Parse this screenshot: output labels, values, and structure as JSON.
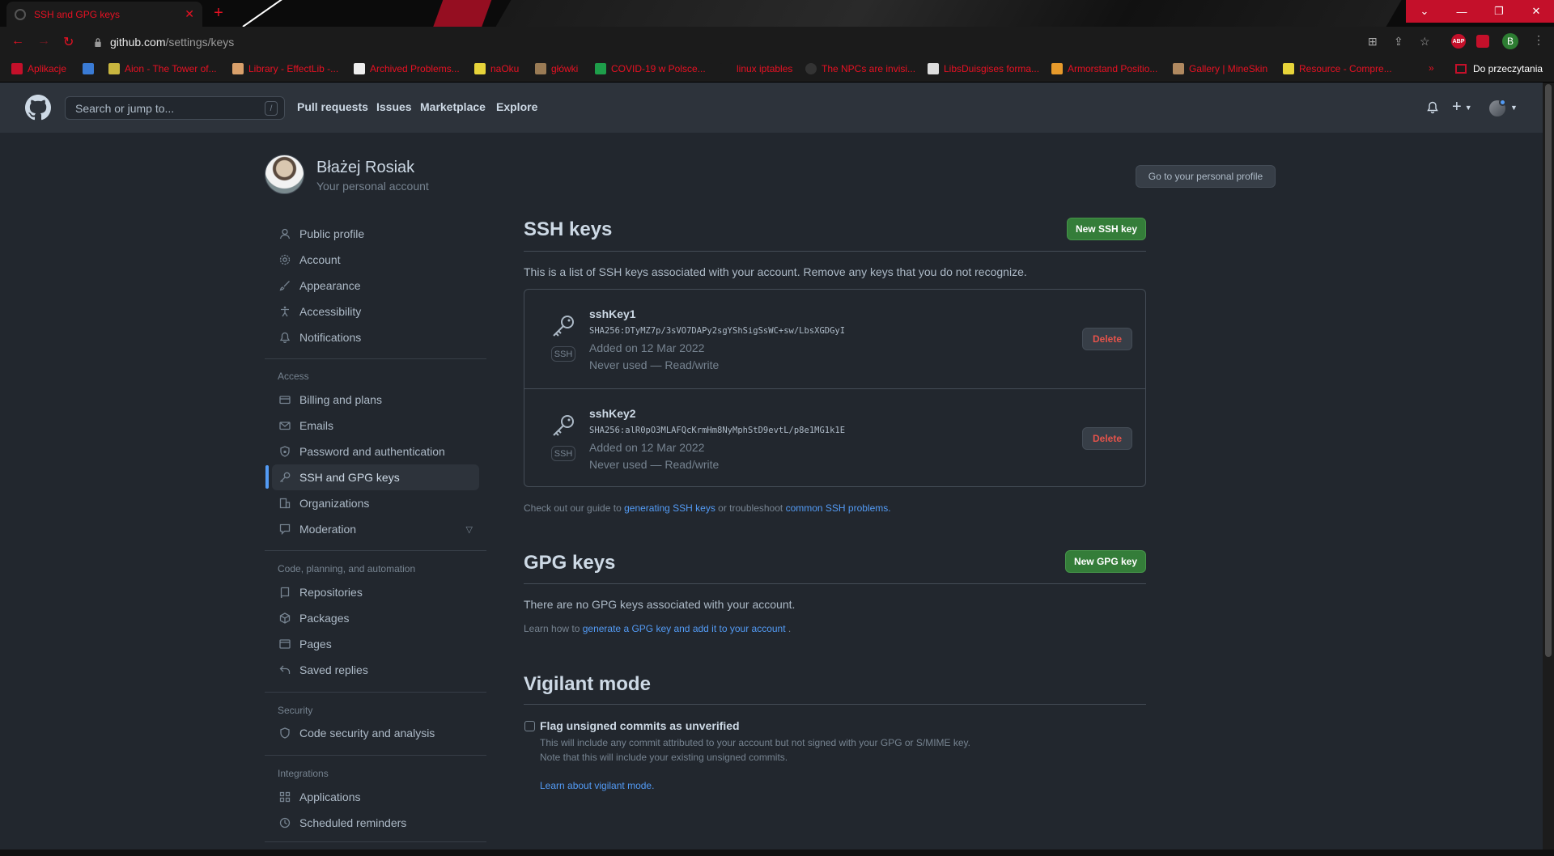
{
  "browser": {
    "tab_title": "SSH and GPG keys",
    "url_domain": "github.com",
    "url_path": "/settings/keys",
    "bookmarks": [
      "Aplikacje",
      "Aion - The Tower of...",
      "Library - EffectLib -...",
      "Archived Problems...",
      "naOku",
      "główki",
      "COVID-19 w Polsce...",
      "linux iptables",
      "The NPCs are invisi...",
      "LibsDuisgises forma...",
      "Armorstand Positio...",
      "Gallery | MineSkin",
      "Resource - Compre..."
    ],
    "bookmarks_more": "»",
    "reading_list": "Do przeczytania",
    "profile_initial": "B",
    "accent": "#c4102a"
  },
  "header": {
    "search_placeholder": "Search or jump to...",
    "search_shortcut": "/",
    "nav": [
      "Pull requests",
      "Issues",
      "Marketplace",
      "Explore"
    ]
  },
  "profile": {
    "name": "Błażej Rosiak",
    "subtitle": "Your personal account",
    "go_button": "Go to your personal profile"
  },
  "sidebar": {
    "items_top": [
      "Public profile",
      "Account",
      "Appearance",
      "Accessibility",
      "Notifications"
    ],
    "access_heading": "Access",
    "items_access": [
      "Billing and plans",
      "Emails",
      "Password and authentication",
      "SSH and GPG keys",
      "Organizations",
      "Moderation"
    ],
    "code_heading": "Code, planning, and automation",
    "items_code": [
      "Repositories",
      "Packages",
      "Pages",
      "Saved replies"
    ],
    "security_heading": "Security",
    "items_security": [
      "Code security and analysis"
    ],
    "integrations_heading": "Integrations",
    "items_integrations": [
      "Applications",
      "Scheduled reminders"
    ]
  },
  "ssh": {
    "title": "SSH keys",
    "new_button": "New SSH key",
    "description": "This is a list of SSH keys associated with your account. Remove any keys that you do not recognize.",
    "keys": [
      {
        "label": "SSH",
        "name": "sshKey1",
        "fingerprint": "SHA256:DTyMZ7p/3sVO7DAPy2sgYShSigSsWC+sw/LbsXGDGyI",
        "added": "Added on 12 Mar 2022",
        "usage": "Never used — Read/write",
        "delete": "Delete"
      },
      {
        "label": "SSH",
        "name": "sshKey2",
        "fingerprint": "SHA256:alR0pO3MLAFQcKrmHm8NyMphStD9evtL/p8e1MG1k1E",
        "added": "Added on 12 Mar 2022",
        "usage": "Never used — Read/write",
        "delete": "Delete"
      }
    ],
    "guide_prefix": "Check out our guide to",
    "guide_link": "generating SSH keys",
    "guide_middle": "or troubleshoot",
    "guide_link2": "common SSH problems."
  },
  "gpg": {
    "title": "GPG keys",
    "new_button": "New GPG key",
    "empty": "There are no GPG keys associated with your account.",
    "learn_prefix": "Learn how to",
    "learn_link": "generate a GPG key and add it to your account",
    "learn_suffix": "."
  },
  "vigilant": {
    "title": "Vigilant mode",
    "checkbox_label": "Flag unsigned commits as unverified",
    "note1": "This will include any commit attributed to your account but not signed with your GPG or S/MIME key.",
    "note2": "Note that this will include your existing unsigned commits.",
    "learn_link": "Learn about vigilant mode."
  }
}
